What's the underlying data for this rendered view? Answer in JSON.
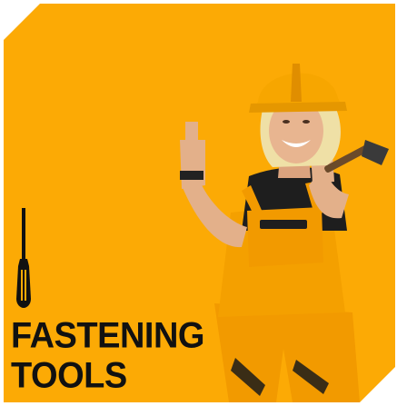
{
  "category": {
    "title_line_1": "FASTENING",
    "title_line_2": "TOOLS",
    "icon": "screwdriver-icon",
    "image_subject": "worker-in-hard-hat-and-overalls"
  },
  "colors": {
    "background": "#fcaa05",
    "text": "#111111",
    "page": "#ffffff"
  }
}
